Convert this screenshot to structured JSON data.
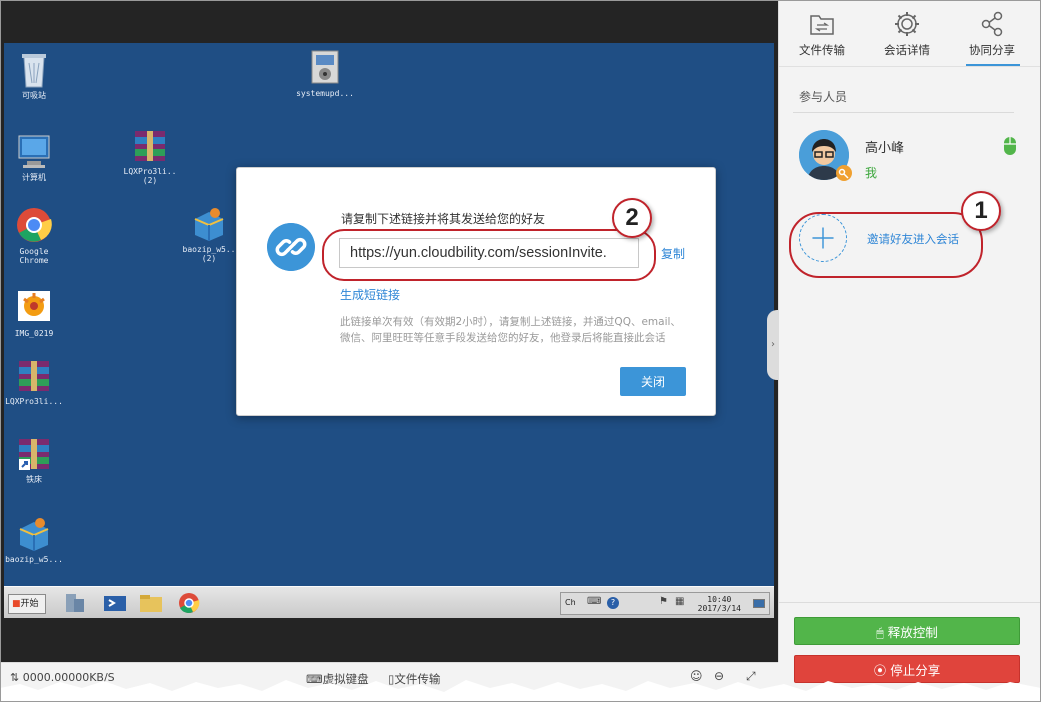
{
  "desktop": {
    "icons": [
      {
        "label": "可吸站",
        "icon": "recycle-bin-icon"
      },
      {
        "label": "计算机",
        "icon": "computer-icon"
      },
      {
        "label": "Google\nChrome",
        "icon": "chrome-icon"
      },
      {
        "label": "IMG_0219",
        "icon": "image-file-icon"
      },
      {
        "label": "LQXPro3li...",
        "icon": "rar-archive-icon"
      },
      {
        "label": "铁床",
        "icon": "rar-shortcut-icon"
      },
      {
        "label": "baozip_w5...",
        "icon": "baozip-icon"
      },
      {
        "label": "systemupd...",
        "icon": "installer-icon"
      },
      {
        "label": "LQXPro3li..\n(2)",
        "icon": "rar-archive-icon"
      },
      {
        "label": "baozip_w5..\n(2)",
        "icon": "baozip-icon"
      }
    ],
    "taskbar": {
      "start_label": "开始",
      "clock": "10:40\n2017/3/14",
      "lang": "Ch"
    }
  },
  "dialog": {
    "title": "请复制下述链接并将其发送给您的好友",
    "url": "https://yun.cloudbility.com/sessionInvite.",
    "copy_label": "复制",
    "short_link_label": "生成短链接",
    "note": "此链接单次有效（有效期2小时），请复制上述链接，并通过QQ、email、微信、阿里旺旺等任意手段发送给您的好友，他登录后将能直接此会话",
    "close_label": "关闭"
  },
  "annotations": {
    "badge1": "1",
    "badge2": "2",
    "color": "#c0232b"
  },
  "panel": {
    "tabs": [
      {
        "label": "文件传输",
        "icon": "file-transfer-icon"
      },
      {
        "label": "会话详情",
        "icon": "gear-icon"
      },
      {
        "label": "协同分享",
        "icon": "share-icon",
        "active": true
      }
    ],
    "participants_label": "参与人员",
    "participant": {
      "name": "高小峰",
      "tag": "我"
    },
    "invite_label": "邀请好友进入会话",
    "release_label": "释放控制",
    "stop_label": "停止分享"
  },
  "bottombar": {
    "speed": "0000.00000KB/S",
    "virtual_keyboard": "虚拟键盘",
    "file_transfer": "文件传输"
  },
  "colors": {
    "accent": "#3c95d8",
    "green": "#52b54a",
    "red": "#e0443c",
    "desktop": "#1f4e84"
  }
}
